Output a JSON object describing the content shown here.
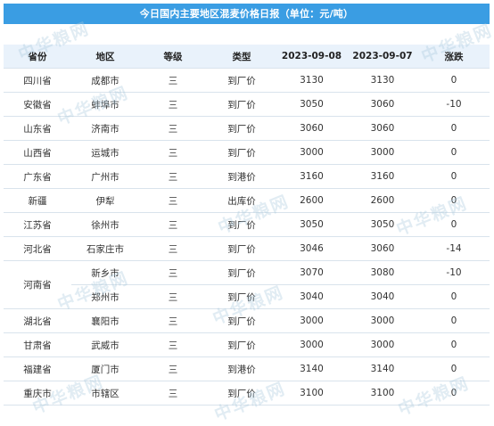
{
  "title": "今日国内主要地区混麦价格日报（单位：元/吨）",
  "header": [
    "省份",
    "地区",
    "等级",
    "类型",
    "2023-09-08",
    "2023-09-07",
    "涨跌"
  ],
  "rows": [
    [
      "四川省",
      "成都市",
      "三",
      "到厂价",
      "3130",
      "3130",
      "0"
    ],
    [
      "安徽省",
      "蚌埠市",
      "三",
      "到厂价",
      "3050",
      "3060",
      "-10"
    ],
    [
      "山东省",
      "济南市",
      "三",
      "到厂价",
      "3060",
      "3060",
      "0"
    ],
    [
      "山西省",
      "运城市",
      "三",
      "到厂价",
      "3000",
      "3000",
      "0"
    ],
    [
      "广东省",
      "广州市",
      "三",
      "到港价",
      "3160",
      "3160",
      "0"
    ],
    [
      "新疆",
      "伊犁",
      "三",
      "出库价",
      "2600",
      "2600",
      "0"
    ],
    [
      "江苏省",
      "徐州市",
      "三",
      "到厂价",
      "3050",
      "3050",
      "0"
    ],
    [
      "河北省",
      "石家庄市",
      "三",
      "到厂价",
      "3046",
      "3060",
      "-14"
    ],
    [
      "河南省",
      "新乡市",
      "三",
      "到厂价",
      "3070",
      "3080",
      "-10"
    ],
    [
      "",
      "郑州市",
      "三",
      "到厂价",
      "3040",
      "3040",
      "0"
    ],
    [
      "湖北省",
      "襄阳市",
      "三",
      "到厂价",
      "3000",
      "3000",
      "0"
    ],
    [
      "甘肃省",
      "武威市",
      "三",
      "到厂价",
      "3000",
      "3000",
      "0"
    ],
    [
      "福建省",
      "厦门市",
      "三",
      "到港价",
      "3140",
      "3140",
      "0"
    ],
    [
      "重庆市",
      "市辖区",
      "三",
      "到厂价",
      "3100",
      "3100",
      "0"
    ]
  ],
  "watermark_text": "中华粮网",
  "colors": {
    "title_bg": "#3a9de3",
    "header_bg": "#e9f2fb",
    "change_negative": "#29a745",
    "border": "#d9e3ec"
  }
}
